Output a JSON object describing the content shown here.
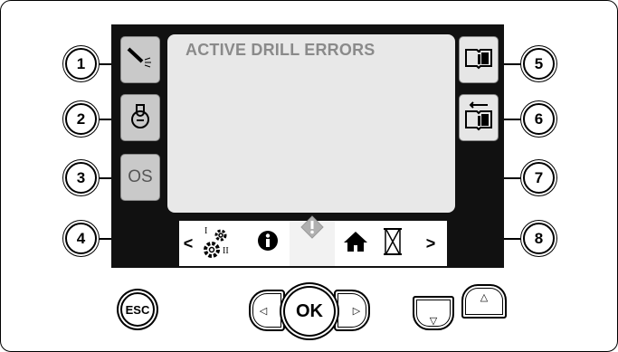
{
  "screen": {
    "title": "ACTIVE DRILL ERRORS",
    "left_softkeys": [
      {
        "icon": "spray-icon"
      },
      {
        "icon": "drill-motor-icon"
      },
      {
        "label": "OS"
      }
    ],
    "right_softkeys": [
      {
        "icon": "book-info-icon"
      },
      {
        "icon": "book-return-icon"
      }
    ],
    "tabbar": {
      "prev": "<",
      "next": ">",
      "gear_roman_1": "I",
      "gear_roman_2": "II"
    }
  },
  "callouts": [
    "1",
    "2",
    "3",
    "4",
    "5",
    "6",
    "7",
    "8"
  ],
  "hardware": {
    "esc_label": "ESC",
    "ok_label": "OK",
    "left_arrow": "◁",
    "right_arrow": "▷",
    "down_arrow": "▽",
    "up_arrow": "△"
  }
}
